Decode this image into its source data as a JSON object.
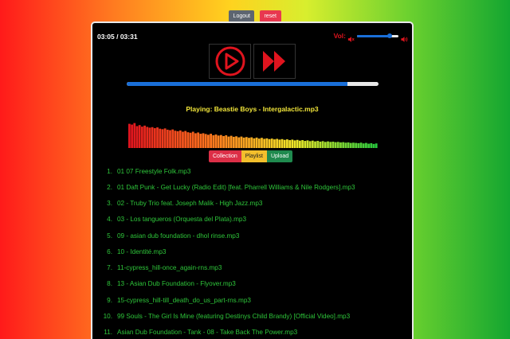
{
  "top_buttons": {
    "logout": "Logout",
    "reset": "reset"
  },
  "player": {
    "time": "03:05 / 03:31",
    "volume_label": "Vol:",
    "volume_level": 0.78,
    "progress": 0.877,
    "now_playing_prefix": "Playing:",
    "now_playing_track": "Beastie Boys - Intergalactic.mp3",
    "controls": {
      "play": "play-icon",
      "next": "fast-forward-icon"
    },
    "visualizer_levels": [
      0.95,
      0.92,
      0.98,
      0.86,
      0.9,
      0.84,
      0.88,
      0.83,
      0.8,
      0.82,
      0.78,
      0.81,
      0.76,
      0.74,
      0.77,
      0.72,
      0.7,
      0.73,
      0.68,
      0.66,
      0.69,
      0.64,
      0.67,
      0.62,
      0.6,
      0.64,
      0.58,
      0.61,
      0.56,
      0.58,
      0.55,
      0.52,
      0.56,
      0.5,
      0.53,
      0.49,
      0.51,
      0.47,
      0.5,
      0.45,
      0.48,
      0.44,
      0.46,
      0.42,
      0.45,
      0.41,
      0.43,
      0.4,
      0.42,
      0.38,
      0.41,
      0.37,
      0.4,
      0.36,
      0.38,
      0.35,
      0.37,
      0.34,
      0.36,
      0.33,
      0.35,
      0.32,
      0.34,
      0.31,
      0.33,
      0.3,
      0.32,
      0.29,
      0.31,
      0.28,
      0.3,
      0.27,
      0.29,
      0.26,
      0.28,
      0.25,
      0.27,
      0.24,
      0.26,
      0.24,
      0.25,
      0.23,
      0.24,
      0.22,
      0.23,
      0.21,
      0.22,
      0.2,
      0.21,
      0.2,
      0.19,
      0.21,
      0.18,
      0.2,
      0.17,
      0.19,
      0.16,
      0.18
    ]
  },
  "tabs": {
    "collection": "Collection",
    "playlist": "Playlist",
    "upload": "Upload"
  },
  "playlist": [
    {
      "num": "1.",
      "title": "01 07 Freestyle Folk.mp3"
    },
    {
      "num": "2.",
      "title": "01 Daft Punk - Get Lucky (Radio Edit) [feat. Pharrell Williams & Nile Rodgers].mp3"
    },
    {
      "num": "3.",
      "title": "02 - Truby Trio feat. Joseph Malik - High Jazz.mp3"
    },
    {
      "num": "4.",
      "title": "03 - Los tangueros (Orquesta del Plata).mp3"
    },
    {
      "num": "5.",
      "title": "09 - asian dub foundation - dhol rinse.mp3"
    },
    {
      "num": "6.",
      "title": "10 - Identité.mp3"
    },
    {
      "num": "7.",
      "title": "11-cypress_hill-once_again-rns.mp3"
    },
    {
      "num": "8.",
      "title": "13 - Asian Dub Foundation - Flyover.mp3"
    },
    {
      "num": "9.",
      "title": "15-cypress_hill-till_death_do_us_part-rns.mp3"
    },
    {
      "num": "10.",
      "title": "99 Souls - The Girl Is Mine (featuring Destinys Child Brandy) [Official Video].mp3"
    },
    {
      "num": "11.",
      "title": "Asian Dub Foundation - Tank - 08 - Take Back The Power.mp3"
    }
  ]
}
